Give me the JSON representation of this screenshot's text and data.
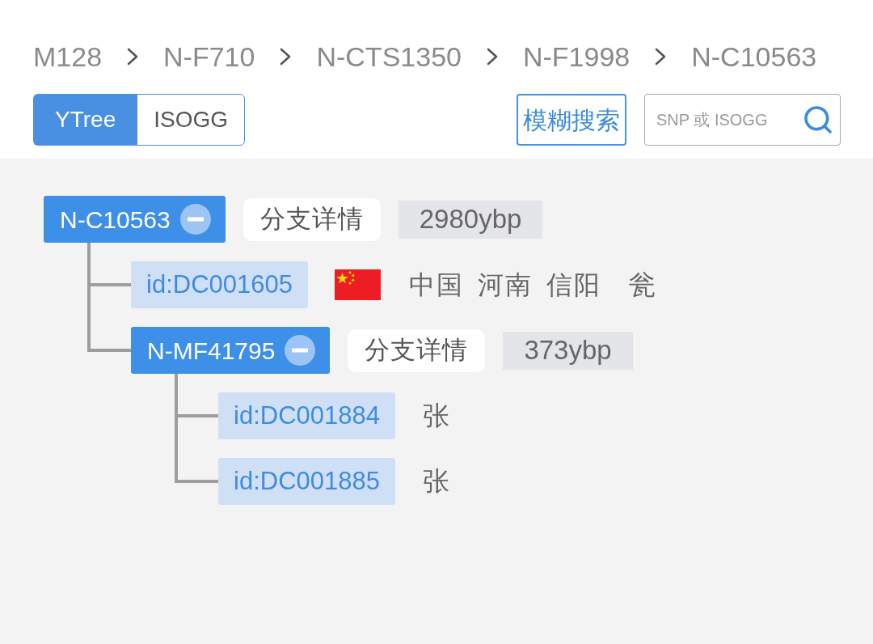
{
  "breadcrumb": {
    "items": [
      "M128",
      "N-F710",
      "N-CTS1350",
      "N-F1998",
      "N-C10563"
    ]
  },
  "tree_source_tabs": [
    {
      "label": "YTree",
      "selected": true
    },
    {
      "label": "ISOGG",
      "selected": false
    }
  ],
  "fuzzy_search_button": {
    "label": "模糊搜索"
  },
  "search": {
    "placeholder": "SNP 或 ISOGG"
  },
  "tree": [
    {
      "kind": "branch",
      "label": "N-C10563",
      "expanded": true,
      "details_button": "分支详情",
      "age": "2980ybp",
      "children": [
        {
          "kind": "sample",
          "label": "id:DC001605",
          "location": "中国 河南 信阳",
          "surname": "瓮"
        },
        {
          "kind": "branch",
          "label": "N-MF41795",
          "expanded": true,
          "details_button": "分支详情",
          "age": "373ybp",
          "children": [
            {
              "kind": "sample",
              "label": "id:DC001884",
              "surname": "张"
            },
            {
              "kind": "sample",
              "label": "id:DC001885",
              "surname": "张"
            }
          ]
        }
      ]
    }
  ]
}
